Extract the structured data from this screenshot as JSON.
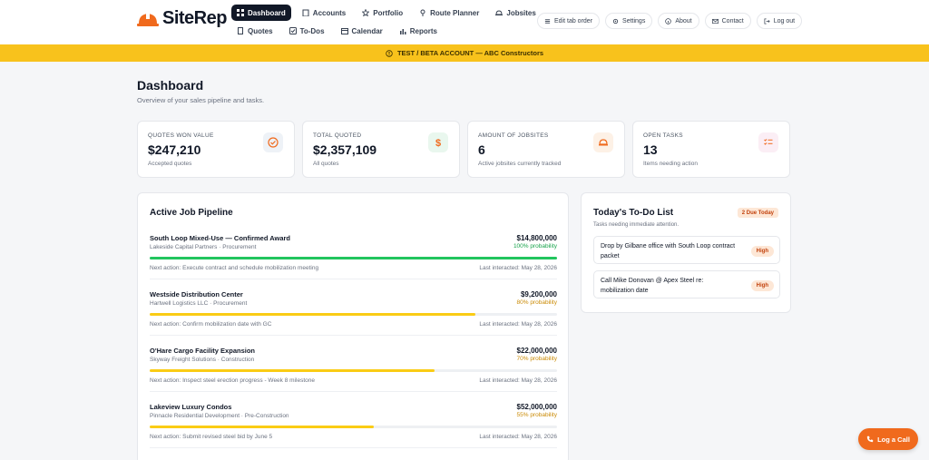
{
  "brand": {
    "name": "SiteRep",
    "accent": "#f06a1d"
  },
  "nav": {
    "row1": [
      {
        "label": "Dashboard",
        "icon": "dashboard-icon",
        "active": true
      },
      {
        "label": "Accounts",
        "icon": "building-icon"
      },
      {
        "label": "Portfolio",
        "icon": "star-icon"
      },
      {
        "label": "Route Planner",
        "icon": "map-pin-icon"
      },
      {
        "label": "Jobsites",
        "icon": "hardhat-icon"
      }
    ],
    "row2": [
      {
        "label": "Quotes",
        "icon": "document-icon"
      },
      {
        "label": "To-Dos",
        "icon": "checklist-icon"
      },
      {
        "label": "Calendar",
        "icon": "calendar-icon"
      },
      {
        "label": "Reports",
        "icon": "bar-chart-icon"
      }
    ]
  },
  "utility": {
    "edit_tab_order": "Edit tab order",
    "settings": "Settings",
    "about": "About",
    "contact": "Contact",
    "logout": "Log out"
  },
  "banner": {
    "text": "TEST / BETA ACCOUNT — ABC Constructors"
  },
  "page": {
    "title": "Dashboard",
    "subtitle": "Overview of your sales pipeline and tasks."
  },
  "stats": [
    {
      "label": "QUOTES WON VALUE",
      "value": "$247,210",
      "desc": "Accepted quotes",
      "icon": "check-circle-icon"
    },
    {
      "label": "TOTAL QUOTED",
      "value": "$2,357,109",
      "desc": "All quotes",
      "icon": "dollar-icon"
    },
    {
      "label": "AMOUNT OF JOBSITES",
      "value": "6",
      "desc": "Active jobsites currently tracked",
      "icon": "hardhat-icon"
    },
    {
      "label": "OPEN TASKS",
      "value": "13",
      "desc": "Items needing action",
      "icon": "checklist-icon"
    }
  ],
  "pipeline": {
    "title": "Active Job Pipeline",
    "jobs": [
      {
        "name": "South Loop Mixed-Use — Confirmed Award",
        "client": "Lakeside Capital Partners · Procurement",
        "amount": "$14,800,000",
        "probability_label": "100% probability",
        "probability": 100,
        "next": "Next action: Execute contract and schedule mobilization meeting",
        "last": "Last interacted: May 28, 2026",
        "color": "#22c55e",
        "text_color": "#16a34a"
      },
      {
        "name": "Westside Distribution Center",
        "client": "Hartwell Logistics LLC · Procurement",
        "amount": "$9,200,000",
        "probability_label": "80% probability",
        "probability": 80,
        "next": "Next action: Confirm mobilization date with GC",
        "last": "Last interacted: May 28, 2026",
        "color": "#facc15",
        "text_color": "#ca8a04"
      },
      {
        "name": "O'Hare Cargo Facility Expansion",
        "client": "Skyway Freight Solutions · Construction",
        "amount": "$22,000,000",
        "probability_label": "70% probability",
        "probability": 70,
        "next": "Next action: Inspect steel erection progress - Week 8 milestone",
        "last": "Last interacted: May 28, 2026",
        "color": "#facc15",
        "text_color": "#ca8a04"
      },
      {
        "name": "Lakeview Luxury Condos",
        "client": "Pinnacle Residential Development · Pre-Construction",
        "amount": "$52,000,000",
        "probability_label": "55% probability",
        "probability": 55,
        "next": "Next action: Submit revised steel bid by June 5",
        "last": "Last interacted: May 28, 2026",
        "color": "#facc15",
        "text_color": "#ca8a04"
      }
    ]
  },
  "todo": {
    "title": "Today's To-Do List",
    "badge": "2 Due Today",
    "subtitle": "Tasks needing immediate attention.",
    "tasks": [
      {
        "text": "Drop by Gilbane office with South Loop contract packet",
        "priority": "High"
      },
      {
        "text": "Call Mike Donovan @ Apex Steel re: mobilization date",
        "priority": "High"
      }
    ]
  },
  "fab": {
    "label": "Log a Call"
  }
}
